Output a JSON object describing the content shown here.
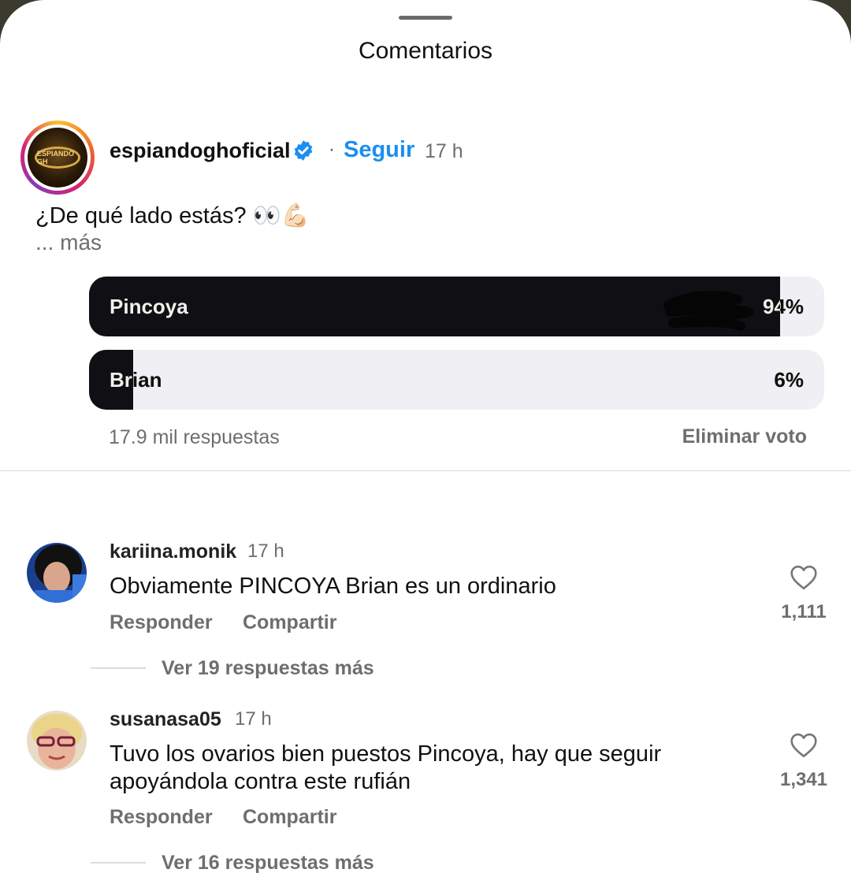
{
  "sheet": {
    "title": "Comentarios"
  },
  "post": {
    "avatar_text": "ESPIANDO GH",
    "username": "espiandoghoficial",
    "separator": "·",
    "follow_label": "Seguir",
    "time": "17 h",
    "caption": "¿De qué lado estás? 👀💪🏻",
    "more_label": "... más"
  },
  "poll": {
    "options": [
      {
        "label": "Pincoya",
        "percent_text": "94%",
        "percent": 94
      },
      {
        "label": "Brian",
        "percent_text": "6%",
        "percent": 6
      }
    ],
    "responses": "17.9 mil respuestas",
    "remove_vote_label": "Eliminar voto"
  },
  "comments": [
    {
      "username": "kariina.monik",
      "time": "17 h",
      "text": "Obviamente PINCOYA Brian es un ordinario",
      "reply_label": "Responder",
      "share_label": "Compartir",
      "likes": "1,111",
      "view_replies": "Ver 19 respuestas más"
    },
    {
      "username": "susanasa05",
      "time": "17 h",
      "text": "Tuvo los ovarios bien puestos Pincoya, hay que seguir apoyándola contra este rufián",
      "reply_label": "Responder",
      "share_label": "Compartir",
      "likes": "1,341",
      "view_replies": "Ver 16 respuestas más"
    }
  ],
  "colors": {
    "accent_blue": "#1c8ef0",
    "poll_fill": "#0f0f14",
    "poll_track": "#efeff4",
    "muted_text": "#6e6e6e"
  },
  "icons": [
    "verified-badge-icon",
    "heart-icon"
  ]
}
